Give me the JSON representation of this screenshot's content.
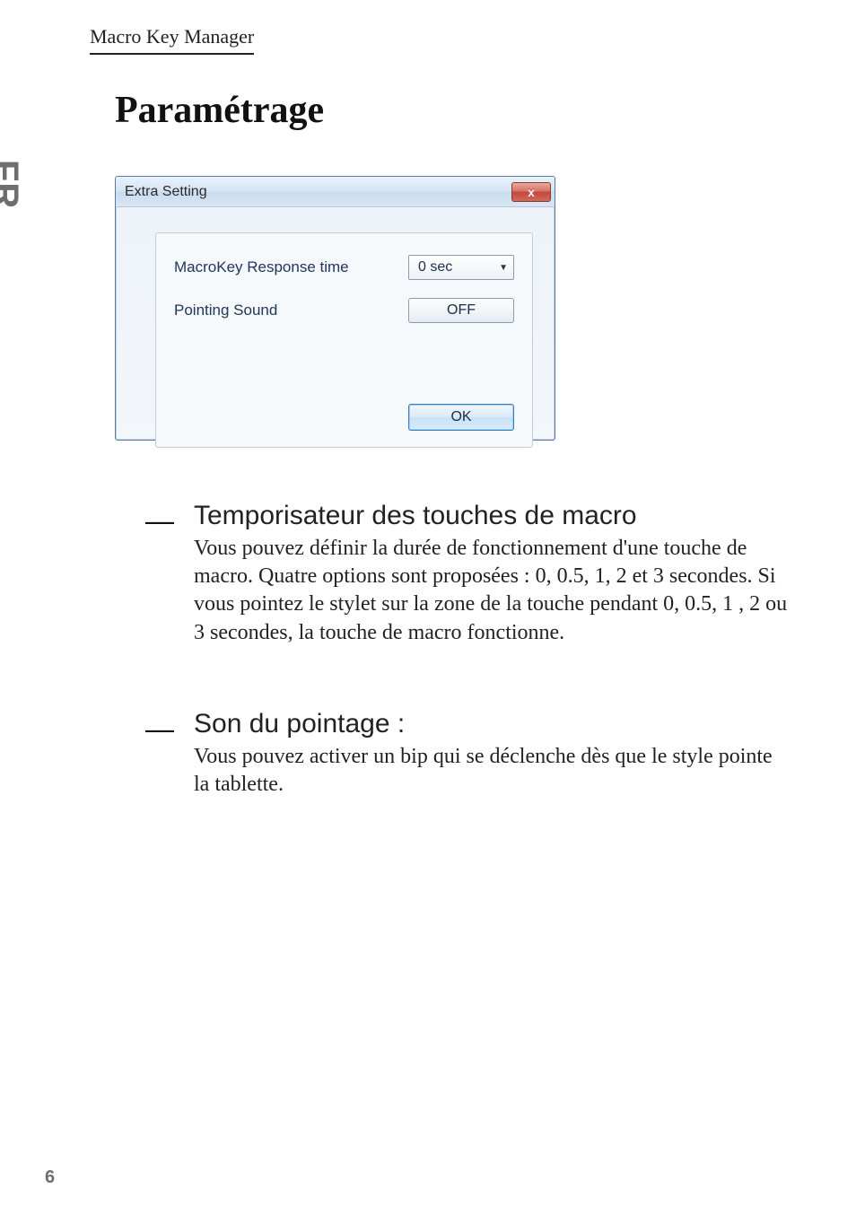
{
  "header": {
    "title": "Macro Key Manager"
  },
  "lang_tab": "FR",
  "page_heading": "Paramétrage",
  "dialog": {
    "title": "Extra Setting",
    "close_label": "x",
    "response_label": "MacroKey Response time",
    "response_value": "0 sec",
    "sound_label": "Pointing Sound",
    "sound_value": "OFF",
    "ok_label": "OK"
  },
  "sections": [
    {
      "dash": "―",
      "title": "Temporisateur des touches de macro",
      "body": "Vous pouvez définir la durée de fonctionnement d'une touche de macro. Quatre options sont proposées : 0, 0.5, 1, 2 et 3 secondes. Si vous pointez le stylet sur la zone de la touche pendant 0, 0.5, 1 , 2 ou 3 secondes, la touche de macro fonctionne."
    },
    {
      "dash": "―",
      "title": "Son du pointage :",
      "body": "Vous pouvez activer un bip qui se déclenche dès que le style pointe la tablette."
    }
  ],
  "page_number": "6"
}
